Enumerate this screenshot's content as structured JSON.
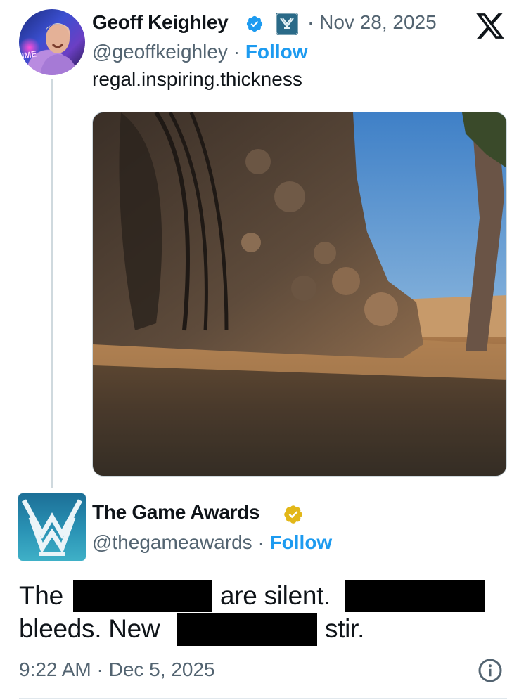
{
  "tweet": {
    "author_name": "Geoff Keighley",
    "handle": "@geoffkeighley",
    "separator": "·",
    "follow_label": "Follow",
    "date": "· Nov 28, 2025",
    "text": "regal.inspiring.thickness",
    "avatar_text": "IME",
    "media_alt": "Carved stone monolith with twisted figures in a desert at sunset"
  },
  "quote": {
    "author_name": "The Game Awards",
    "handle": "@thegameawards",
    "follow_label": "Follow",
    "text_parts": {
      "the": "The",
      "are_silent": "are silent.",
      "bleeds_new": "bleeds. New",
      "stir": "stir."
    },
    "timestamp": "9:22 AM · Dec 5, 2025"
  },
  "icons": {
    "verified_blue": "verified-blue-badge-icon",
    "verified_gold": "verified-gold-badge-icon",
    "affiliate": "affiliate-badge-icon",
    "x_logo": "x-logo-icon",
    "info": "info-icon"
  },
  "colors": {
    "accent": "#1d9bf0",
    "secondary_text": "#536471",
    "gold": "#e2b719",
    "thread_line": "#cfd9de"
  }
}
